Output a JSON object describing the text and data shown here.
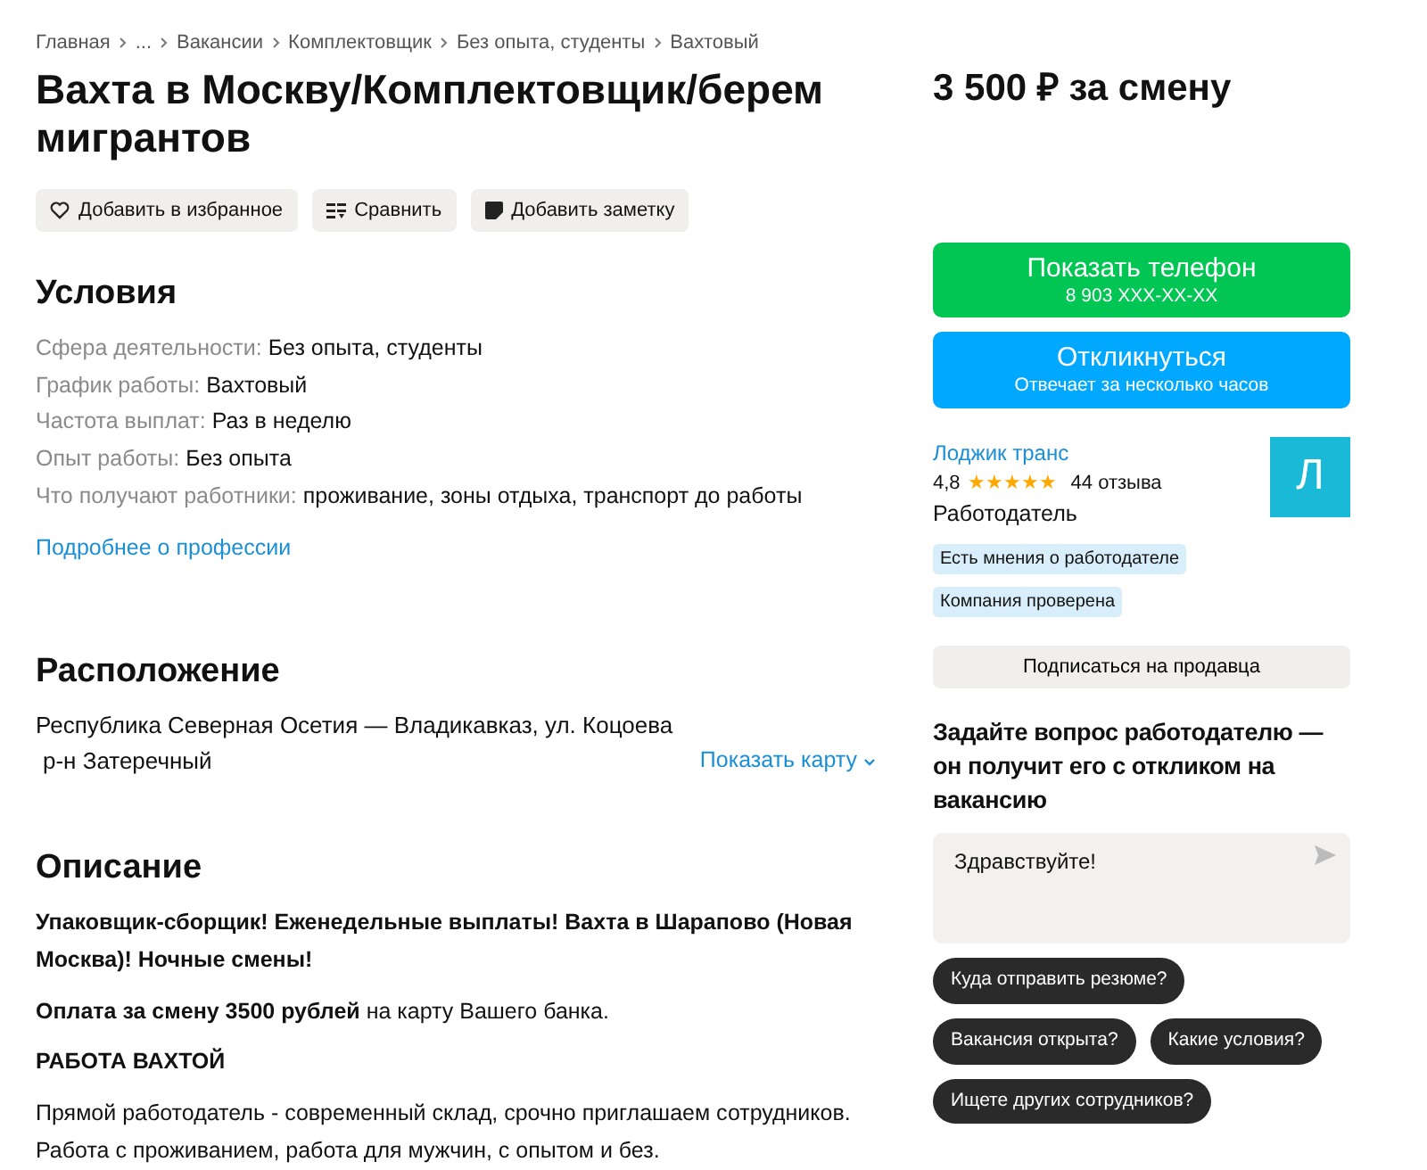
{
  "breadcrumbs": [
    "Главная",
    "...",
    "Вакансии",
    "Комплектовщик",
    "Без опыта, студенты",
    "Вахтовый"
  ],
  "title": "Вахта в Москву/Комплектовщик/берем мигрантов",
  "actions": [
    {
      "kind": "heart",
      "label": "Добавить в избранное"
    },
    {
      "kind": "compare",
      "label": "Сравнить"
    },
    {
      "kind": "note",
      "label": "Добавить заметку"
    }
  ],
  "conditions": {
    "heading": "Условия",
    "items": [
      {
        "label": "Сфера деятельности:",
        "value": "Без опыта, студенты"
      },
      {
        "label": "График работы:",
        "value": "Вахтовый"
      },
      {
        "label": "Частота выплат:",
        "value": "Раз в неделю"
      },
      {
        "label": "Опыт работы:",
        "value": "Без опыта"
      },
      {
        "label": "Что получают работники:",
        "value": "проживание, зоны отдыха, транспорт до работы"
      }
    ],
    "link": "Подробнее о профессии"
  },
  "location": {
    "heading": "Расположение",
    "address": "Республика Северная Осетия — Владикавказ, ул. Коцоева",
    "district": "р-н Затеречный",
    "map_link": "Показать карту"
  },
  "description": {
    "heading": "Описание",
    "paragraphs": [
      {
        "text": "Упаковщик-сборщик! Еженедельные выплаты! Вахта в Шарапово (Новая Москва)! Ночные смены!",
        "bold": true
      },
      {
        "text": "**Оплата за смену 3500 рублей** на карту Вашего банка.",
        "bold": false
      },
      {
        "text": "РАБОТА ВАХТОЙ",
        "bold": true
      },
      {
        "text": "Прямой работодатель - современный склад, срочно приглашаем сотрудников. Работа с проживанием, работа для мужчин, с опытом и без.",
        "bold": false
      }
    ]
  },
  "price": "3 500 ₽ за смену",
  "phone_button": {
    "label": "Показать телефон",
    "sub": "8 903 XXX-XX-XX"
  },
  "respond_button": {
    "label": "Откликнуться",
    "sub": "Отвечает за несколько часов"
  },
  "employer": {
    "name": "Лоджик транс",
    "rating": "4,8",
    "stars": 5,
    "reviews": "44 отзыва",
    "role": "Работодатель",
    "avatar": "Л",
    "badges": [
      "Есть мнения о работодателе",
      "Компания проверена"
    ],
    "subscribe": "Подписаться на продавца"
  },
  "question": {
    "heading": "Задайте вопрос работодателю — он получит его с откликом на вакансию",
    "message": "Здравствуйте!",
    "chips": [
      "Куда отправить резюме?",
      "Вакансия открыта?",
      "Какие условия?",
      "Ищете других сотрудников?"
    ]
  }
}
